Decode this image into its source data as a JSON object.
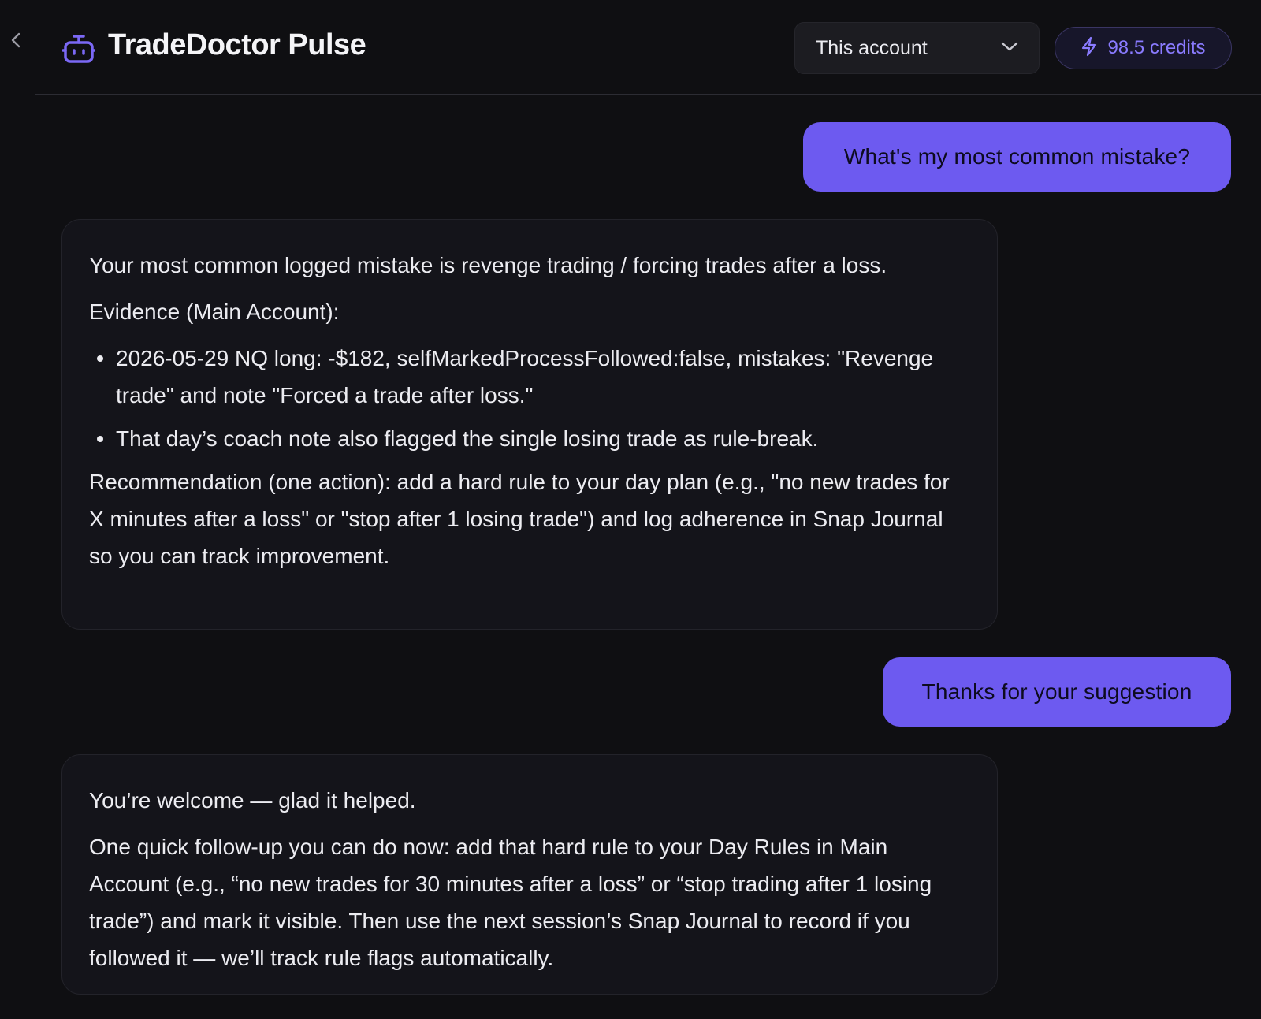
{
  "header": {
    "title": "TradeDoctor Pulse",
    "account_selector": {
      "selected": "This account"
    },
    "credits": {
      "label": "98.5 credits"
    }
  },
  "colors": {
    "accent": "#6d5af0",
    "credits_text": "#8a7bff",
    "background": "#0f0f12",
    "bubble_bg": "#14141a"
  },
  "icons": {
    "back": "chevron-left-icon",
    "logo": "robot-icon",
    "dropdown": "chevron-down-icon",
    "credits": "lightning-bolt-icon"
  },
  "messages": [
    {
      "role": "user",
      "text": "What's my most common mistake?"
    },
    {
      "role": "assistant",
      "intro": "Your most common logged mistake is revenge trading / forcing trades after a loss.",
      "evidence_heading": "Evidence (Main Account):",
      "bullets": [
        "2026-05-29 NQ long: -$182, selfMarkedProcessFollowed:false, mistakes: \"Revenge trade\" and note \"Forced a trade after loss.\"",
        "That day’s coach note also flagged the single losing trade as rule-break."
      ],
      "recommendation": "Recommendation (one action): add a hard rule to your day plan (e.g., \"no new trades for X minutes after a loss\" or \"stop after 1 losing trade\") and log adherence in Snap Journal so you can track improvement."
    },
    {
      "role": "user",
      "text": "Thanks for your suggestion"
    },
    {
      "role": "assistant",
      "intro": "You’re welcome — glad it helped.",
      "body": "One quick follow-up you can do now: add that hard rule to your Day Rules in Main Account (e.g., “no new trades for 30 minutes after a loss” or “stop trading after 1 losing trade”) and mark it visible. Then use the next session’s Snap Journal to record if you followed it — we’ll track rule flags automatically."
    }
  ]
}
